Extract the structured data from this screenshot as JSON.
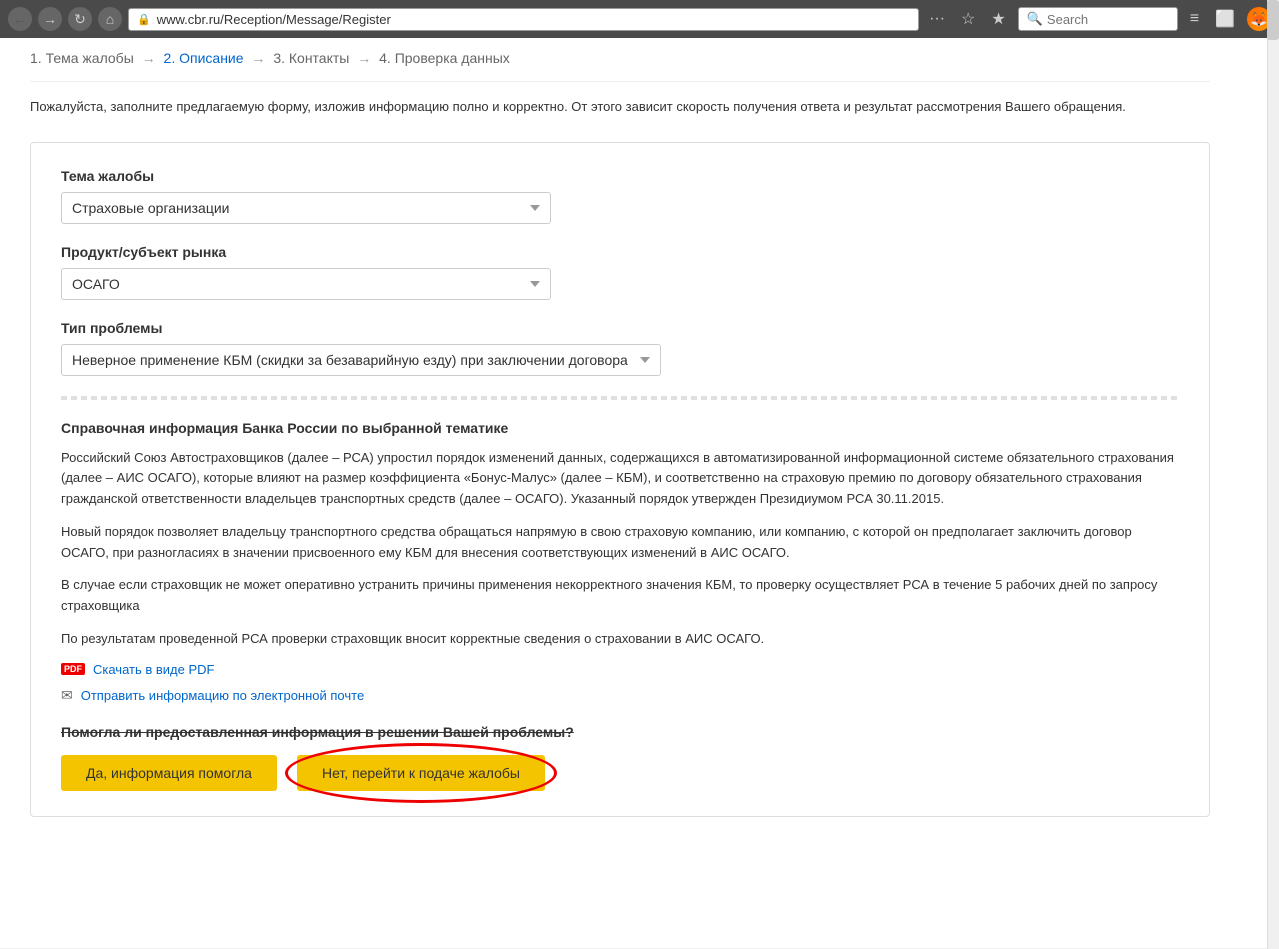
{
  "browser": {
    "back_label": "←",
    "forward_label": "→",
    "reload_label": "↻",
    "home_label": "⌂",
    "url": "www.cbr.ru/Reception/Message/Register",
    "menu_label": "···",
    "bookmark_label": "☆",
    "star_label": "★",
    "search_placeholder": "Search",
    "sidebar_label": "≡",
    "tabs_label": "⬜",
    "firefox_icon": "🦊"
  },
  "steps": {
    "step1": "1. Тема жалобы",
    "arrow1": "→",
    "step2": "2. Описание",
    "arrow2": "→",
    "step3": "3. Контакты",
    "arrow3": "→",
    "step4": "4. Проверка данных"
  },
  "intro": {
    "text": "Пожалуйста, заполните предлагаемую форму, изложив информацию полно и корректно. От этого зависит скорость получения ответа и результат рассмотрения Вашего обращения."
  },
  "form": {
    "subject_label": "Тема жалобы",
    "subject_value": "Страховые организации",
    "product_label": "Продукт/субъект рынка",
    "product_value": "ОСАГО",
    "problem_label": "Тип проблемы",
    "problem_value": "Неверное применение КБМ (скидки за безаварийную езду) при заключении договора"
  },
  "info": {
    "title": "Справочная информация Банка России по выбранной тематике",
    "paragraph1": "Российский Союз Автостраховщиков (далее – РСА) упростил порядок изменений данных, содержащихся в автоматизированной информационной системе обязательного страхования (далее – АИС ОСАГО), которые влияют на размер коэффициента «Бонус-Малус» (далее – КБМ), и соответственно на страховую премию по договору обязательного страхования гражданской ответственности владельцев транспортных средств (далее – ОСАГО). Указанный порядок утвержден Президиумом РСА 30.11.2015.",
    "paragraph2": "Новый порядок позволяет владельцу транспортного средства обращаться напрямую в свою страховую компанию, или компанию, с которой он предполагает заключить договор ОСАГО, при разногласиях в значении присвоенного ему КБМ для внесения соответствующих изменений в АИС ОСАГО.",
    "paragraph3": "В случае если страховщик не может оперативно устранить причины применения некорректного значения КБМ, то проверку осуществляет РСА в течение 5 рабочих дней по запросу страховщика",
    "paragraph4": "По результатам проведенной РСА проверки страховщик вносит корректные сведения о страховании в АИС ОСАГО.",
    "pdf_label": "Скачать в виде PDF",
    "email_label": "Отправить информацию по электронной почте"
  },
  "question": {
    "text": "Помогла ли предоставленная информация в решении Вашей проблемы?",
    "btn_yes": "Да, информация помогла",
    "btn_no": "Нет, перейти к подаче жалобы"
  }
}
